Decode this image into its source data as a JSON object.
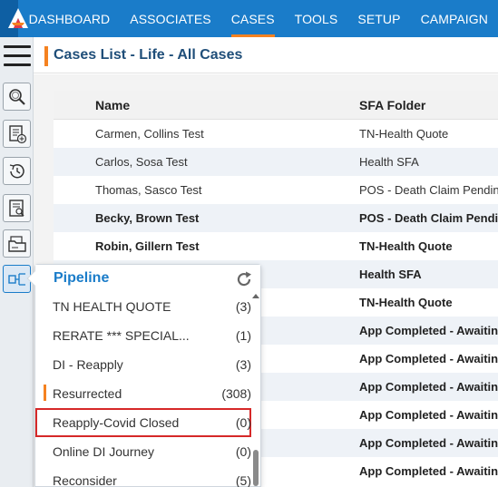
{
  "nav": {
    "items": [
      {
        "label": "DASHBOARD",
        "active": false
      },
      {
        "label": "ASSOCIATES",
        "active": false
      },
      {
        "label": "CASES",
        "active": true
      },
      {
        "label": "TOOLS",
        "active": false
      },
      {
        "label": "SETUP",
        "active": false
      },
      {
        "label": "CAMPAIGN",
        "active": false
      }
    ]
  },
  "page": {
    "title": "Cases List - Life - All Cases"
  },
  "table": {
    "headers": {
      "name": "Name",
      "folder": "SFA Folder"
    },
    "rows": [
      {
        "name": "Carmen, Collins Test",
        "folder": "TN-Health Quote"
      },
      {
        "name": "Carlos, Sosa Test",
        "folder": "Health SFA"
      },
      {
        "name": "Thomas, Sasco Test",
        "folder": "POS - Death Claim Pending"
      },
      {
        "name": "Becky, Brown Test",
        "folder": "POS - Death Claim Pending"
      },
      {
        "name": "Robin, Gillern Test",
        "folder": "TN-Health Quote"
      },
      {
        "name": "",
        "folder": "Health SFA"
      },
      {
        "name": "",
        "folder": "TN-Health Quote"
      },
      {
        "name": "",
        "folder": "App Completed - Awaiting"
      },
      {
        "name": "",
        "folder": "App Completed - Awaiting"
      },
      {
        "name": "",
        "folder": "App Completed - Awaiting"
      },
      {
        "name": "",
        "folder": "App Completed - Awaiting"
      },
      {
        "name": "",
        "folder": "App Completed - Awaiting"
      },
      {
        "name": "",
        "folder": "App Completed - Awaiting"
      }
    ]
  },
  "pipeline": {
    "title": "Pipeline",
    "items": [
      {
        "label": "TN HEALTH QUOTE",
        "count": "(3)"
      },
      {
        "label": "RERATE *** SPECIAL...",
        "count": "(1)"
      },
      {
        "label": "DI - Reapply",
        "count": "(3)"
      },
      {
        "label": "Resurrected",
        "count": "(308)"
      },
      {
        "label": "Reapply-Covid Closed",
        "count": "(0)"
      },
      {
        "label": "Online DI Journey",
        "count": "(0)"
      },
      {
        "label": "Reconsider",
        "count": "(5)"
      }
    ]
  },
  "colors": {
    "brand": "#1a7cc9",
    "accent": "#f58220",
    "highlight": "#d62828"
  },
  "icons": [
    "logo-icon",
    "menu-icon",
    "search-icon",
    "add-document-icon",
    "history-icon",
    "document-search-icon",
    "folder-icon",
    "pipeline-icon",
    "refresh-icon"
  ]
}
